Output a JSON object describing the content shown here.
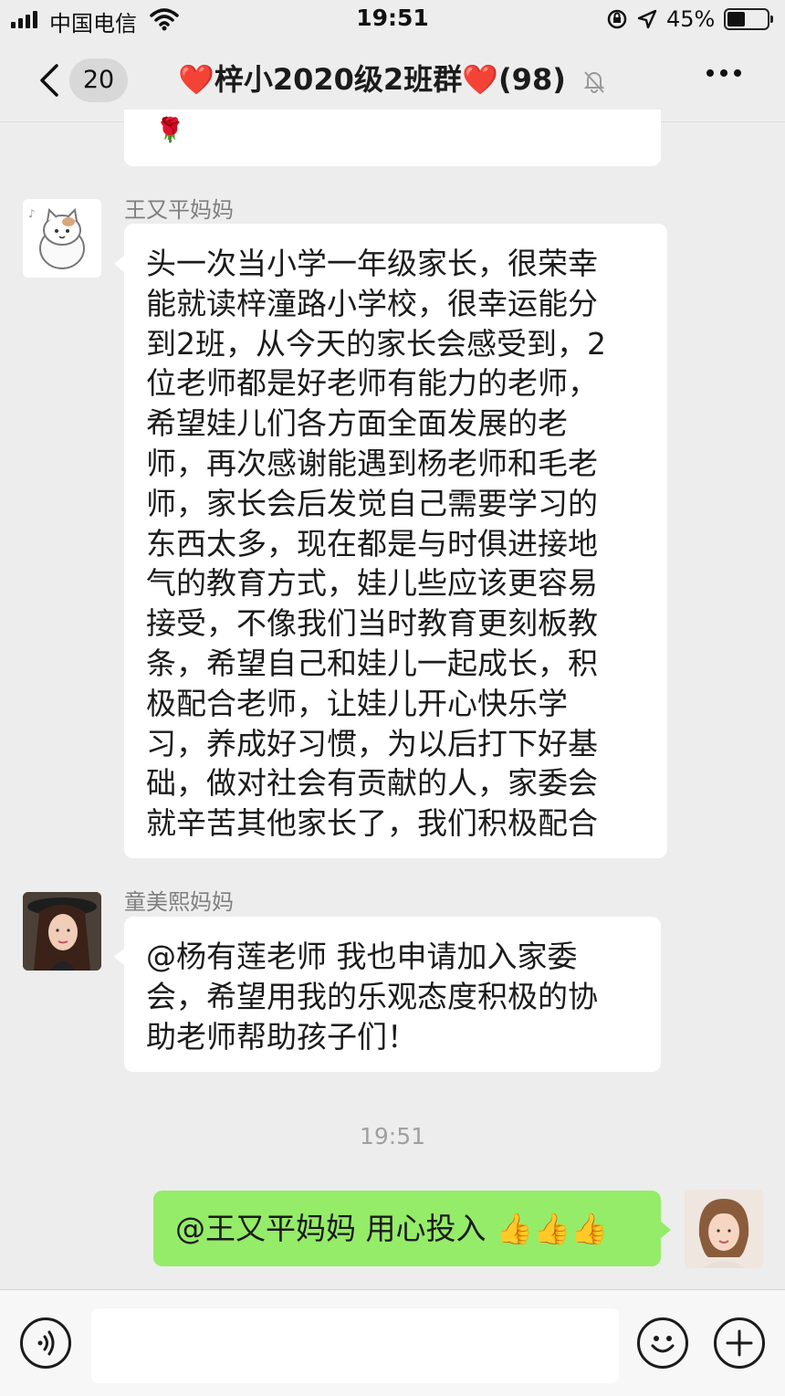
{
  "status_bar": {
    "carrier": "中国电信",
    "time": "19:51",
    "battery_percent": "45%",
    "battery_level": 0.45
  },
  "nav": {
    "unread_count": "20",
    "title_heart_left": "❤️",
    "title_text": "梓小2020级2班群",
    "title_heart_right": "❤️",
    "member_count": "(98)",
    "icons": [
      "back-icon",
      "mute-bell-icon",
      "more-icon"
    ]
  },
  "messages": [
    {
      "sender": "",
      "text": "🌹",
      "side": "left"
    },
    {
      "sender": "王又平妈妈",
      "lines": [
        "头一次当小学一年级家长，很荣幸",
        "能就读梓潼路小学校，很幸运能分",
        "到2班，从今天的家长会感受到，2",
        "位老师都是好老师有能力的老师，",
        "希望娃儿们各方面全面发展的老",
        "师，再次感谢能遇到杨老师和毛老",
        "师，家长会后发觉自己需要学习的",
        "东西太多，现在都是与时俱进接地",
        "气的教育方式，娃儿些应该更容易",
        "接受，不像我们当时教育更刻板教",
        "条，希望自己和娃儿一起成长，积",
        "极配合老师，让娃儿开心快乐学",
        "习，养成好习惯，为以后打下好基",
        "础，做对社会有贡献的人，家委会",
        "就辛苦其他家长了，我们积极配合"
      ],
      "side": "left"
    },
    {
      "sender": "童美熙妈妈",
      "lines": [
        "@杨有莲老师 我也申请加入家委",
        "会，希望用我的乐观态度积极的协",
        "助老师帮助孩子们！"
      ],
      "side": "left"
    },
    {
      "time_divider": "19:51"
    },
    {
      "sender": "",
      "text": "@王又平妈妈 用心投入",
      "emoji": "👍👍👍",
      "side": "right"
    }
  ],
  "input_bar": {
    "icons": [
      "voice-icon",
      "emoji-icon",
      "plus-icon"
    ],
    "placeholder": ""
  },
  "colors": {
    "background": "#ededed",
    "bubble_left": "#ffffff",
    "bubble_right": "#95ec69",
    "sender_name": "#7f7f7f",
    "heart": "#e3232a"
  }
}
